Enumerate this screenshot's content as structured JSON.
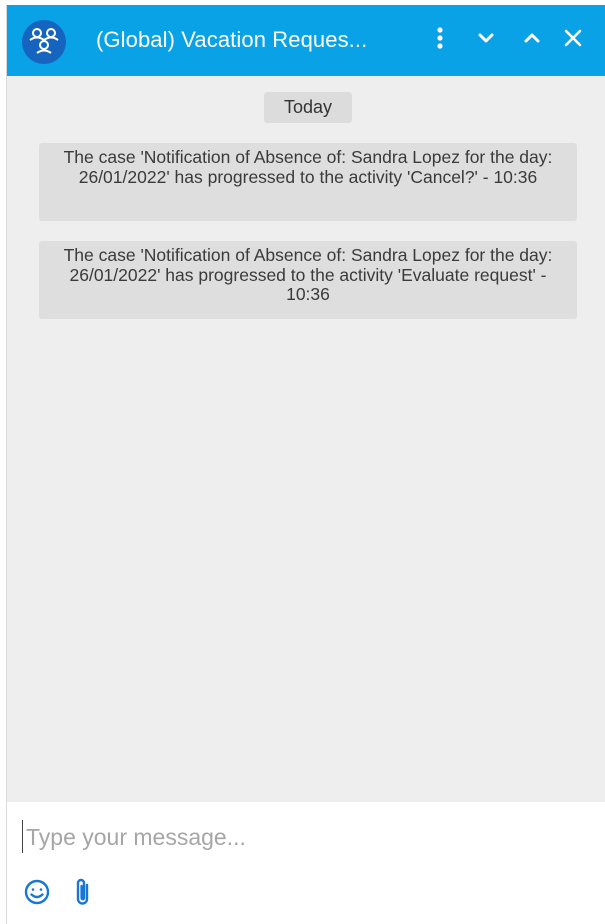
{
  "header": {
    "title": "(Global) Vacation Reques...",
    "avatar_icon": "group-icon",
    "buttons": [
      "more-vert-icon",
      "chevron-down-icon",
      "chevron-up-icon",
      "close-icon"
    ],
    "bg_color": "#0aa2e6"
  },
  "chat": {
    "date_label": "Today",
    "messages": [
      {
        "text": "The case 'Notification of Absence of: Sandra Lopez for the day: 26/01/2022' has progressed to the activity 'Cancel?' - 10:36"
      },
      {
        "text": "The case 'Notification of Absence of: Sandra Lopez for the day: 26/01/2022' has progressed to the activity 'Evaluate request' - 10:36"
      }
    ]
  },
  "composer": {
    "placeholder": "Type your message...",
    "value": "",
    "tools": [
      "emoji-icon",
      "attachment-icon"
    ],
    "icon_color": "#1976d2"
  }
}
